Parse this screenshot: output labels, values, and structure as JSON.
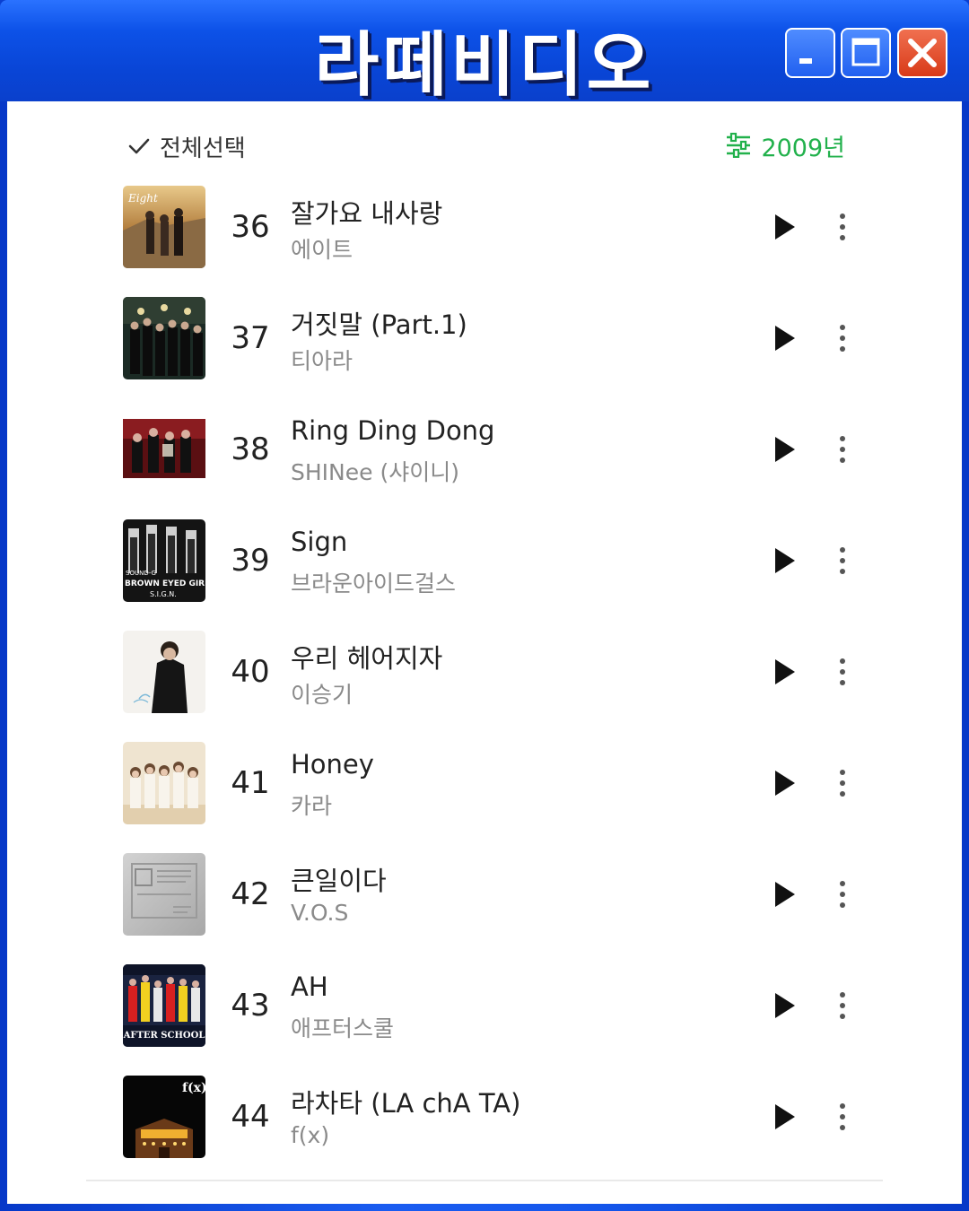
{
  "window": {
    "title": "라떼비디오",
    "colors": {
      "titlebar": "#0a48d8",
      "close_button": "#d83a18",
      "accent_green": "#22b14c"
    }
  },
  "toolbar": {
    "select_all_label": "전체선택",
    "year_filter_label": "2009년"
  },
  "songs": [
    {
      "rank": "36",
      "title": "잘가요 내사랑",
      "artist": "에이트",
      "cover_icon": "album-cover-8eight"
    },
    {
      "rank": "37",
      "title": "거짓말 (Part.1)",
      "artist": "티아라",
      "cover_icon": "album-cover-tara"
    },
    {
      "rank": "38",
      "title": "Ring Ding Dong",
      "artist": "SHINee (샤이니)",
      "cover_icon": "album-cover-shinee"
    },
    {
      "rank": "39",
      "title": "Sign",
      "artist": "브라운아이드걸스",
      "cover_icon": "album-cover-beg",
      "cover_text": "SOUND-G BROWN EYED GIRLS S.I.G.N."
    },
    {
      "rank": "40",
      "title": "우리 헤어지자",
      "artist": "이승기",
      "cover_icon": "album-cover-leeseunggi"
    },
    {
      "rank": "41",
      "title": "Honey",
      "artist": "카라",
      "cover_icon": "album-cover-kara"
    },
    {
      "rank": "42",
      "title": "큰일이다",
      "artist": "V.O.S",
      "cover_icon": "album-cover-vos"
    },
    {
      "rank": "43",
      "title": "AH",
      "artist": "애프터스쿨",
      "cover_icon": "album-cover-afterschool",
      "cover_text": "AFTER SCHOOL"
    },
    {
      "rank": "44",
      "title": "라차타 (LA chA TA)",
      "artist": "f(x)",
      "cover_icon": "album-cover-fx",
      "cover_text": "f(x)"
    }
  ]
}
